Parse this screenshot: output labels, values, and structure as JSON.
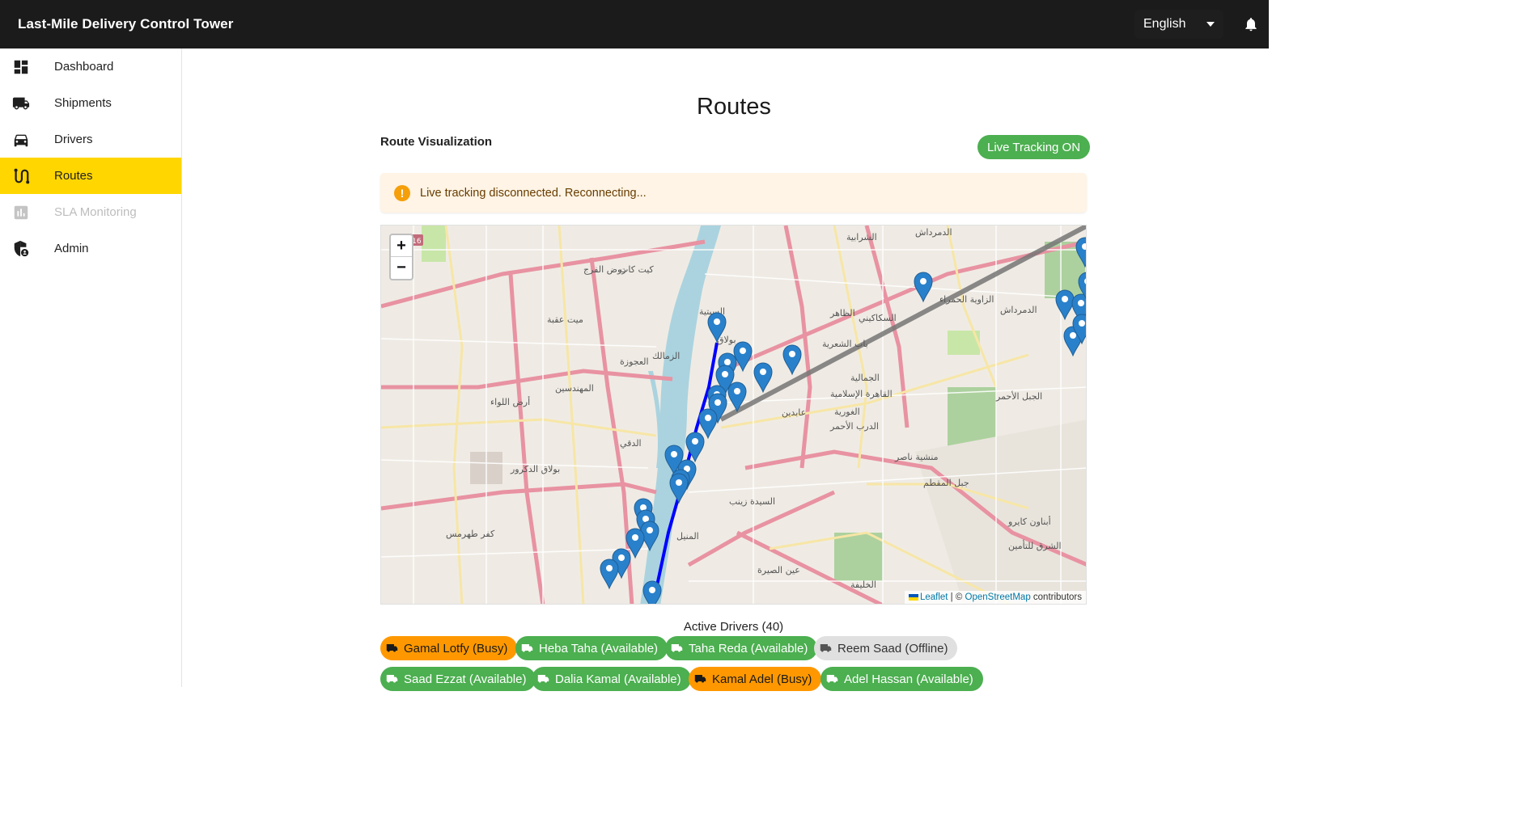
{
  "header": {
    "title": "Last-Mile Delivery Control Tower",
    "language": "English"
  },
  "sidebar": {
    "items": [
      {
        "label": "Dashboard",
        "icon": "dashboard-icon",
        "state": "normal"
      },
      {
        "label": "Shipments",
        "icon": "truck-icon",
        "state": "normal"
      },
      {
        "label": "Drivers",
        "icon": "car-icon",
        "state": "normal"
      },
      {
        "label": "Routes",
        "icon": "route-icon",
        "state": "active"
      },
      {
        "label": "SLA Monitoring",
        "icon": "bar-chart-icon",
        "state": "disabled"
      },
      {
        "label": "Admin",
        "icon": "shield-admin-icon",
        "state": "normal"
      }
    ]
  },
  "main": {
    "page_title": "Routes",
    "section_label": "Route Visualization",
    "live_tracking_label": "Live Tracking ON",
    "alert_message": "Live tracking disconnected. Reconnecting...",
    "map": {
      "zoom_in": "+",
      "zoom_out": "−",
      "attribution_leaflet": "Leaflet",
      "attribution_sep": " | © ",
      "attribution_osm": "OpenStreetMap",
      "attribution_tail": " contributors",
      "place_labels": [
        "الزاوية الحمراء",
        "روض الفرج",
        "كيت كات",
        "الشرابية",
        "الدمرداش",
        "ميت عقبة",
        "العجوزة",
        "المهندسين",
        "أرض اللواء",
        "بولاق الدكرور",
        "كفر طهرمس",
        "الزمالك",
        "السبتية",
        "بولاق",
        "باب الشعرية",
        "السكاكيني",
        "الظاهر",
        "الجمالية",
        "القاهرة الإسلامية",
        "الغورية",
        "الدرب الأحمر",
        "عابدين",
        "الدقي",
        "منشية ناصر",
        "جبل المقطم",
        "السيدة زينب",
        "المنيل",
        "عين الصيرة",
        "الخليفة",
        "أبناون كايرو",
        "الشرق للتأمين",
        "الجبل الأحمر",
        "الدمرداش",
        "516"
      ]
    },
    "drivers_title": "Active Drivers (40)",
    "drivers": [
      {
        "label": "Gamal Lotfy (Busy)",
        "status": "busy"
      },
      {
        "label": "Heba Taha (Available)",
        "status": "available"
      },
      {
        "label": "Taha Reda (Available)",
        "status": "available"
      },
      {
        "label": "Reem Saad (Offline)",
        "status": "offline"
      },
      {
        "label": "Saad Ezzat (Available)",
        "status": "available"
      },
      {
        "label": "Dalia Kamal (Available)",
        "status": "available"
      },
      {
        "label": "Kamal Adel (Busy)",
        "status": "busy"
      },
      {
        "label": "Adel Hassan (Available)",
        "status": "available"
      }
    ]
  },
  "colors": {
    "accent": "#ffd600",
    "topbar": "#1b1b1b",
    "available": "#4caf50",
    "busy": "#ff9800",
    "offline": "#e0e0e0",
    "route_blue": "#0000ff",
    "route_gray": "#757575",
    "marker": "#2a81cb"
  }
}
